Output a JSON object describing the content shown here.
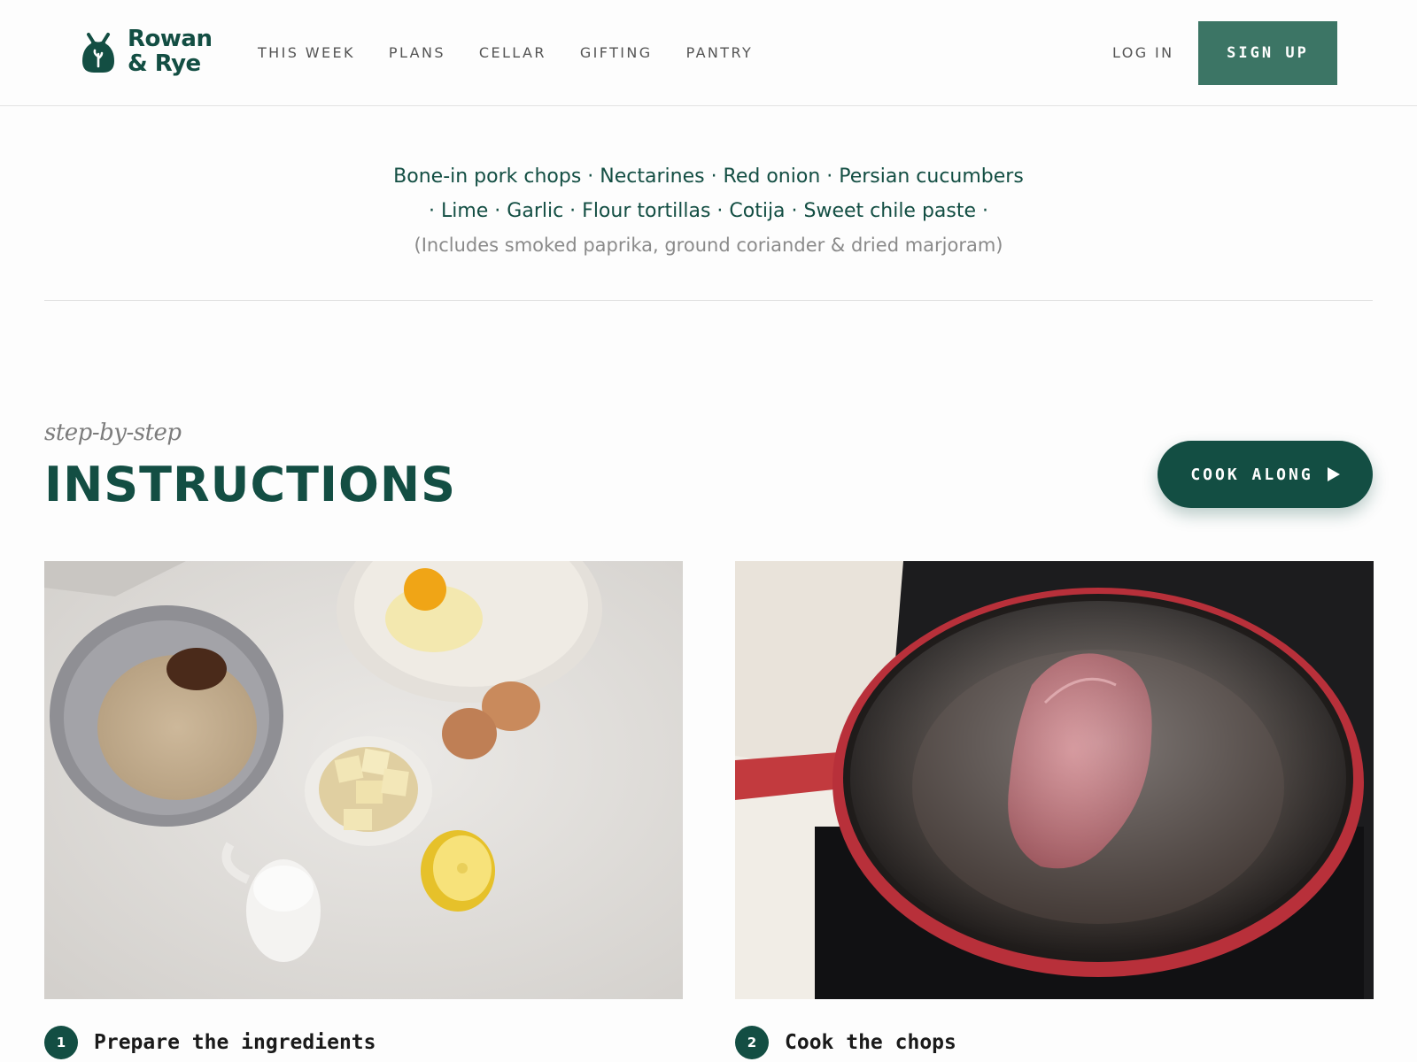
{
  "brand": {
    "line1": "Rowan",
    "line2": "& Rye",
    "accent": "#134e43",
    "button": "#3c7565"
  },
  "nav": [
    {
      "label": "THIS WEEK"
    },
    {
      "label": "PLANS"
    },
    {
      "label": "CELLAR"
    },
    {
      "label": "GIFTING"
    },
    {
      "label": "PANTRY"
    }
  ],
  "auth": {
    "login": "LOG IN",
    "signup": "SIGN UP"
  },
  "ingredients": {
    "line1": "Bone-in pork chops · Nectarines · Red onion · Persian cucumbers",
    "line2": "· Lime · Garlic · Flour tortillas · Cotija · Sweet chile paste ·",
    "note": "(Includes smoked paprika, ground coriander & dried marjoram)"
  },
  "instructions": {
    "kicker": "step-by-step",
    "title": "INSTRUCTIONS",
    "cook_along": "COOK ALONG",
    "steps": [
      {
        "number": "1",
        "title": "Prepare the ingredients",
        "image": "ingredients-flatlay-photo"
      },
      {
        "number": "2",
        "title": "Cook the chops",
        "image": "searing-meat-in-skillet-photo"
      }
    ]
  }
}
